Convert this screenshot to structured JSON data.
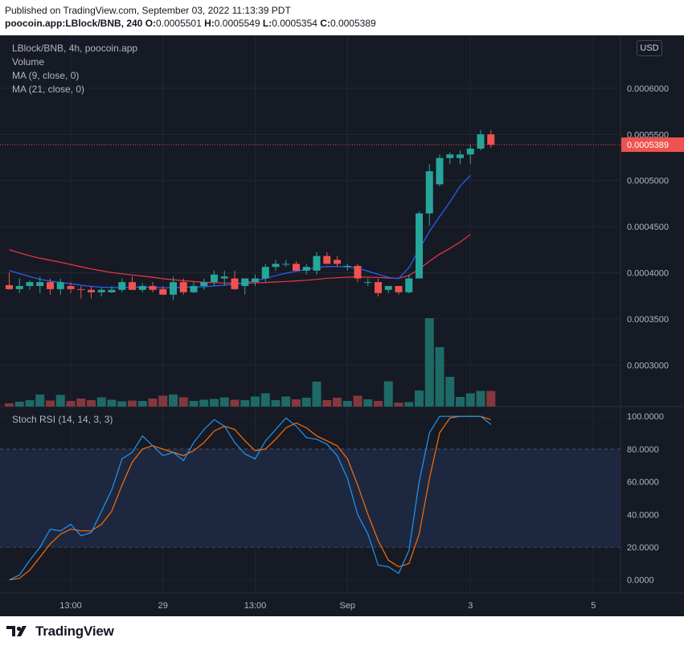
{
  "header": {
    "published": "Published on TradingView.com, September 03, 2022 11:13:39 PDT",
    "symbol_line": "poocoin.app:LBlock/BNB, 240",
    "o_label": "O:",
    "o": "0.0005501",
    "h_label": "H:",
    "h": "0.0005549",
    "l_label": "L:",
    "l": "0.0005354",
    "c_label": "C:",
    "c": "0.0005389"
  },
  "legend": {
    "title": "LBlock/BNB, 4h, poocoin.app",
    "volume": "Volume",
    "ma9": "MA (9, close, 0)",
    "ma21": "MA (21, close, 0)",
    "stoch": "Stoch RSI (14, 14, 3, 3)"
  },
  "currency_button": "USD",
  "brand": "TradingView",
  "colors": {
    "background": "#161a25",
    "up": "#26a69a",
    "down": "#ef5350",
    "ma9": "#2962ff",
    "ma21": "#f23645",
    "stoch_k": "#2196f3",
    "stoch_d": "#ff6d00",
    "band": "#1e2c45"
  },
  "chart_data": [
    {
      "type": "candlestick",
      "title": "LBlock/BNB, 4h, poocoin.app",
      "x_ticks": [
        {
          "label": "13:00",
          "index": 6
        },
        {
          "label": "29",
          "index": 15
        },
        {
          "label": "13:00",
          "index": 24
        },
        {
          "label": "Sep",
          "index": 33
        },
        {
          "label": "3",
          "index": 45
        },
        {
          "label": "5",
          "index": 57
        }
      ],
      "ylim": [
        0.000255,
        0.00064
      ],
      "y_ticks": [
        "0.0003000",
        "0.0003500",
        "0.0004000",
        "0.0004500",
        "0.0005000",
        "0.0005500",
        "0.0006000"
      ],
      "last_price": "0.0005389",
      "candles": [
        {
          "o": 0.0003866,
          "h": 0.0004005,
          "l": 0.0003815,
          "c": 0.0003823
        },
        {
          "o": 0.0003823,
          "h": 0.0003939,
          "l": 0.000378,
          "c": 0.0003857
        },
        {
          "o": 0.0003857,
          "h": 0.0003915,
          "l": 0.0003815,
          "c": 0.0003899
        },
        {
          "o": 0.0003857,
          "h": 0.000396,
          "l": 0.000378,
          "c": 0.0003899
        },
        {
          "o": 0.0003899,
          "h": 0.0003939,
          "l": 0.0003763,
          "c": 0.0003823
        },
        {
          "o": 0.0003823,
          "h": 0.0003939,
          "l": 0.0003763,
          "c": 0.0003899
        },
        {
          "o": 0.0003857,
          "h": 0.0003897,
          "l": 0.000378,
          "c": 0.0003823
        },
        {
          "o": 0.0003823,
          "h": 0.0003857,
          "l": 0.0003722,
          "c": 0.0003815
        },
        {
          "o": 0.0003815,
          "h": 0.0003857,
          "l": 0.0003722,
          "c": 0.0003789
        },
        {
          "o": 0.0003789,
          "h": 0.0003841,
          "l": 0.0003743,
          "c": 0.0003815
        },
        {
          "o": 0.0003789,
          "h": 0.0003857,
          "l": 0.000378,
          "c": 0.0003815
        },
        {
          "o": 0.0003815,
          "h": 0.0003939,
          "l": 0.0003789,
          "c": 0.0003899
        },
        {
          "o": 0.0003899,
          "h": 0.000396,
          "l": 0.0003815,
          "c": 0.0003815
        },
        {
          "o": 0.0003815,
          "h": 0.0003887,
          "l": 0.0003789,
          "c": 0.0003857
        },
        {
          "o": 0.0003857,
          "h": 0.0003899,
          "l": 0.0003789,
          "c": 0.0003815
        },
        {
          "o": 0.0003823,
          "h": 0.0003857,
          "l": 0.0003763,
          "c": 0.0003763
        },
        {
          "o": 0.0003763,
          "h": 0.0003957,
          "l": 0.0003705,
          "c": 0.0003899
        },
        {
          "o": 0.0003899,
          "h": 0.0003939,
          "l": 0.0003763,
          "c": 0.0003789
        },
        {
          "o": 0.0003789,
          "h": 0.0003899,
          "l": 0.000378,
          "c": 0.0003857
        },
        {
          "o": 0.0003857,
          "h": 0.0003939,
          "l": 0.0003815,
          "c": 0.0003899
        },
        {
          "o": 0.0003899,
          "h": 0.0004023,
          "l": 0.0003857,
          "c": 0.0003981
        },
        {
          "o": 0.0003939,
          "h": 0.0004023,
          "l": 0.0003857,
          "c": 0.000396
        },
        {
          "o": 0.0003939,
          "h": 0.0004023,
          "l": 0.0003815,
          "c": 0.0003823
        },
        {
          "o": 0.0003857,
          "h": 0.0003899,
          "l": 0.0003763,
          "c": 0.0003939
        },
        {
          "o": 0.0003899,
          "h": 0.0003981,
          "l": 0.0003857,
          "c": 0.0003939
        },
        {
          "o": 0.0003939,
          "h": 0.0004097,
          "l": 0.0003899,
          "c": 0.0004064
        },
        {
          "o": 0.0004064,
          "h": 0.000414,
          "l": 0.0004023,
          "c": 0.0004097
        },
        {
          "o": 0.0004097,
          "h": 0.000414,
          "l": 0.0004064,
          "c": 0.0004097
        },
        {
          "o": 0.0004097,
          "h": 0.0004125,
          "l": 0.0004023,
          "c": 0.0004023
        },
        {
          "o": 0.0004023,
          "h": 0.0004097,
          "l": 0.0003981,
          "c": 0.0004064
        },
        {
          "o": 0.0004023,
          "h": 0.0004225,
          "l": 0.0003981,
          "c": 0.0004182
        },
        {
          "o": 0.0004182,
          "h": 0.0004225,
          "l": 0.0004097,
          "c": 0.0004097
        },
        {
          "o": 0.000414,
          "h": 0.0004182,
          "l": 0.0004064,
          "c": 0.0004097
        },
        {
          "o": 0.0004064,
          "h": 0.0004097,
          "l": 0.0004023,
          "c": 0.0004075
        },
        {
          "o": 0.0004075,
          "h": 0.0004097,
          "l": 0.0003899,
          "c": 0.0003939
        },
        {
          "o": 0.0003899,
          "h": 0.0003939,
          "l": 0.0003857,
          "c": 0.0003899
        },
        {
          "o": 0.0003899,
          "h": 0.0003939,
          "l": 0.0003743,
          "c": 0.000378
        },
        {
          "o": 0.0003815,
          "h": 0.0003857,
          "l": 0.000378,
          "c": 0.0003857
        },
        {
          "o": 0.0003857,
          "h": 0.0003857,
          "l": 0.0003763,
          "c": 0.0003789
        },
        {
          "o": 0.0003789,
          "h": 0.0003981,
          "l": 0.000378,
          "c": 0.0003939
        },
        {
          "o": 0.0003939,
          "h": 0.0004666,
          "l": 0.0003939,
          "c": 0.0004644
        },
        {
          "o": 0.0004644,
          "h": 0.0005177,
          "l": 0.0004514,
          "c": 0.0005101
        },
        {
          "o": 0.0004959,
          "h": 0.0005283,
          "l": 0.0004938,
          "c": 0.0005244
        },
        {
          "o": 0.0005244,
          "h": 0.0005304,
          "l": 0.0005177,
          "c": 0.0005283
        },
        {
          "o": 0.0005244,
          "h": 0.0005325,
          "l": 0.0005177,
          "c": 0.0005283
        },
        {
          "o": 0.0005283,
          "h": 0.0005389,
          "l": 0.0005177,
          "c": 0.0005346
        },
        {
          "o": 0.0005346,
          "h": 0.0005549,
          "l": 0.0005325,
          "c": 0.0005501
        },
        {
          "o": 0.0005501,
          "h": 0.0005549,
          "l": 0.0005354,
          "c": 0.0005389
        }
      ],
      "volume": [
        8,
        12,
        16,
        30,
        15,
        29,
        14,
        20,
        16,
        23,
        17,
        13,
        15,
        14,
        20,
        27,
        30,
        23,
        14,
        17,
        19,
        23,
        17,
        16,
        25,
        33,
        16,
        25,
        18,
        22,
        62,
        16,
        22,
        14,
        27,
        18,
        14,
        63,
        10,
        11,
        40,
        220,
        148,
        74,
        24,
        33,
        39,
        39
      ],
      "ma9": [
        0.0004025,
        0.0003992,
        0.0003959,
        0.0003929,
        0.000391,
        0.0003895,
        0.0003882,
        0.0003866,
        0.0003852,
        0.0003844,
        0.000384,
        0.000384,
        0.0003843,
        0.0003844,
        0.0003843,
        0.0003838,
        0.000384,
        0.0003843,
        0.0003846,
        0.0003848,
        0.0003857,
        0.0003866,
        0.0003875,
        0.0003891,
        0.0003915,
        0.000394,
        0.0003969,
        0.0003995,
        0.0004018,
        0.0004035,
        0.0004057,
        0.0004069,
        0.0004067,
        0.0004066,
        0.000405,
        0.0004018,
        0.0003984,
        0.000395,
        0.0003937,
        0.0004057,
        0.0004254,
        0.000445,
        0.000461,
        0.0004768,
        0.0004941,
        0.0005056
      ],
      "ma21": [
        0.000425,
        0.0004216,
        0.0004185,
        0.0004158,
        0.0004136,
        0.0004114,
        0.000409,
        0.0004066,
        0.0004042,
        0.0004022,
        0.0004003,
        0.0003989,
        0.0003977,
        0.0003965,
        0.0003952,
        0.0003936,
        0.0003925,
        0.0003914,
        0.0003905,
        0.0003897,
        0.0003893,
        0.000389,
        0.0003887,
        0.0003887,
        0.0003891,
        0.0003895,
        0.0003901,
        0.0003906,
        0.0003912,
        0.0003919,
        0.0003929,
        0.0003941,
        0.0003946,
        0.0003952,
        0.0003955,
        0.0003952,
        0.000395,
        0.0003944,
        0.0003941,
        0.0003971,
        0.000404,
        0.0004126,
        0.0004202,
        0.0004265,
        0.0004333,
        0.0004416
      ]
    },
    {
      "type": "line",
      "title": "Stoch RSI (14, 14, 3, 3)",
      "ylim": [
        -8,
        106
      ],
      "y_ticks": [
        "0.0000",
        "20.0000",
        "40.0000",
        "60.0000",
        "80.0000",
        "100.0000"
      ],
      "band": [
        20,
        80
      ],
      "series": [
        {
          "values": [
            0,
            3,
            12,
            20,
            31,
            30,
            34,
            27,
            29,
            42,
            55,
            74,
            78,
            88,
            82,
            76,
            78,
            73,
            84,
            92,
            98,
            94,
            84,
            77,
            74,
            85,
            92,
            99,
            94,
            87,
            86,
            83,
            76,
            62,
            40,
            28,
            9,
            8,
            4,
            18,
            60,
            90,
            100,
            100,
            100,
            100,
            100,
            95
          ]
        },
        {
          "values": [
            0,
            1,
            6,
            14,
            22,
            28,
            31,
            30,
            30,
            34,
            42,
            58,
            72,
            80,
            82,
            80,
            78,
            76,
            79,
            84,
            91,
            94,
            92,
            85,
            79,
            80,
            86,
            93,
            96,
            93,
            88,
            85,
            82,
            74,
            58,
            40,
            24,
            12,
            8,
            10,
            28,
            62,
            90,
            99,
            100,
            100,
            100,
            98
          ]
        }
      ]
    }
  ]
}
